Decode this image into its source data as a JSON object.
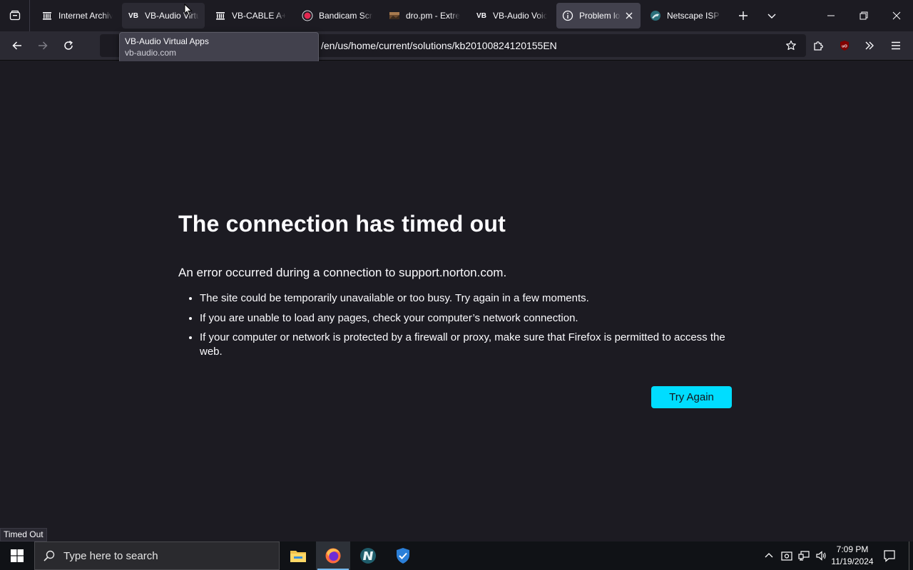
{
  "browser": {
    "tabs": [
      {
        "title": "Internet Archive",
        "favicon": "archive-icon",
        "state": "normal"
      },
      {
        "title": "VB-Audio Virtual Apps",
        "favicon": "vb-icon",
        "state": "hover"
      },
      {
        "title": "VB-CABLE A+B",
        "favicon": "archive-icon",
        "state": "normal"
      },
      {
        "title": "Bandicam Screen Recorder",
        "favicon": "record-icon",
        "state": "normal"
      },
      {
        "title": "dro.pm - Extremely",
        "favicon": "image-icon",
        "state": "normal"
      },
      {
        "title": "VB-Audio VoiceMeeter",
        "favicon": "vb-icon",
        "state": "normal"
      },
      {
        "title": "Problem loading page",
        "favicon": "info-icon",
        "state": "active"
      },
      {
        "title": "Netscape ISP Pages",
        "favicon": "netscape-icon",
        "state": "normal"
      }
    ],
    "tooltip": {
      "title": "VB-Audio Virtual Apps",
      "url": "vb-audio.com"
    },
    "url": {
      "visible": "/en/us/home/current/solutions/kb20100824120155EN"
    },
    "status_text": "Timed Out"
  },
  "error_page": {
    "title": "The connection has timed out",
    "short_desc": "An error occurred during a connection to support.norton.com.",
    "bullets": [
      "The site could be temporarily unavailable or too busy. Try again in a few moments.",
      "If you are unable to load any pages, check your computer’s network connection.",
      "If your computer or network is protected by a firewall or proxy, make sure that Firefox is permitted to access the web."
    ],
    "try_again_label": "Try Again",
    "accent_color": "#00ddff"
  },
  "taskbar": {
    "search_placeholder": "Type here to search",
    "clock_time": "7:09 PM",
    "clock_date": "11/19/2024",
    "apps": [
      "file-explorer-icon",
      "firefox-icon",
      "netscape-icon",
      "shield-icon"
    ]
  }
}
